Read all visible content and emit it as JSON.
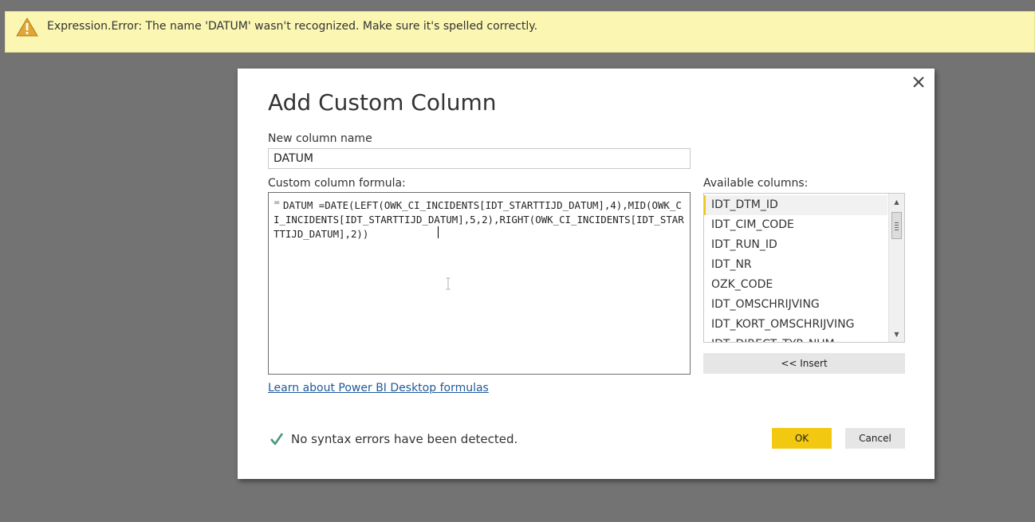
{
  "error_bar": {
    "message": "Expression.Error: The name 'DATUM' wasn't recognized.  Make sure it's spelled correctly.",
    "icon": "warning-icon",
    "colors": {
      "background": "#fbf7b3",
      "icon": "#e2a634"
    }
  },
  "dialog": {
    "title": "Add Custom Column",
    "close_icon": "close-icon",
    "new_column_label": "New column name",
    "new_column_value": "DATUM",
    "formula_label": "Custom column formula:",
    "formula_prefix": "=",
    "formula_value": "DATUM =DATE(LEFT(OWK_CI_INCIDENTS[IDT_STARTTIJD_DATUM],4),MID(OWK_CI_INCIDENTS[IDT_STARTTIJD_DATUM],5,2),RIGHT(OWK_CI_INCIDENTS[IDT_STARTTIJD_DATUM],2))",
    "available_label": "Available columns:",
    "available_columns": [
      "IDT_DTM_ID",
      "IDT_CIM_CODE",
      "IDT_RUN_ID",
      "IDT_NR",
      "OZK_CODE",
      "IDT_OMSCHRIJVING",
      "IDT_KORT_OMSCHRIJVING",
      "IDT_DIRECT_TYP_NUM"
    ],
    "selected_column": "IDT_DTM_ID",
    "insert_label": "<< Insert",
    "learn_link": "Learn about Power BI Desktop formulas",
    "status_text": "No syntax errors have been detected.",
    "status_icon": "checkmark-icon",
    "ok_label": "OK",
    "cancel_label": "Cancel",
    "colors": {
      "accent": "#f2c811",
      "link": "#1f5a9a",
      "check": "#4a9a7a"
    }
  }
}
